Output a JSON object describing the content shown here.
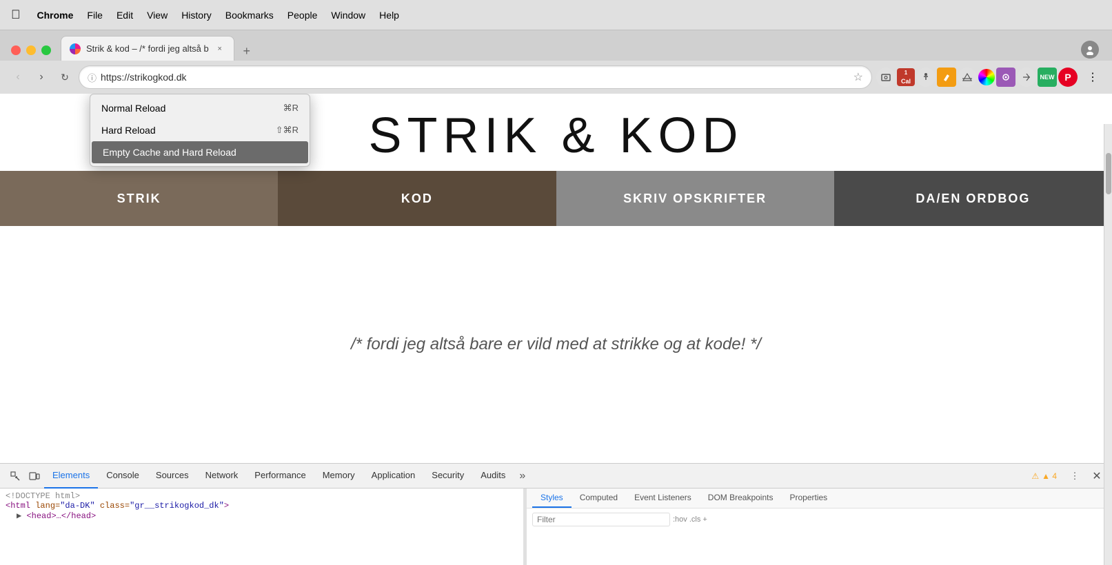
{
  "menubar": {
    "apple": "",
    "app": "Chrome",
    "items": [
      "File",
      "Edit",
      "View",
      "History",
      "Bookmarks",
      "People",
      "Window",
      "Help"
    ]
  },
  "tab": {
    "title": "Strik & kod – /* fordi jeg altså b",
    "close_icon": "×",
    "url": "https://strikogkod.dk"
  },
  "reload_menu": {
    "items": [
      {
        "label": "Normal Reload",
        "shortcut": "⌘R"
      },
      {
        "label": "Hard Reload",
        "shortcut": "⇧⌘R"
      },
      {
        "label": "Empty Cache and Hard Reload",
        "shortcut": ""
      }
    ],
    "selected_index": 2
  },
  "website": {
    "logo": "STRIK & KOD",
    "nav_items": [
      {
        "label": "STRIK",
        "class": "nav-strik"
      },
      {
        "label": "KOD",
        "class": "nav-kod"
      },
      {
        "label": "SKRIV OPSKRIFTER",
        "class": "nav-skriv"
      },
      {
        "label": "DA/EN ORDBOG",
        "class": "nav-daen"
      }
    ],
    "tagline": "/* fordi jeg altså bare er vild med at strikke og at kode! */"
  },
  "devtools": {
    "tabs": [
      "Elements",
      "Console",
      "Sources",
      "Network",
      "Performance",
      "Memory",
      "Application",
      "Security",
      "Audits"
    ],
    "active_tab": "Elements",
    "warning_count": "▲ 4",
    "right_tabs": [
      "Styles",
      "Computed",
      "Event Listeners",
      "DOM Breakpoints",
      "Properties"
    ],
    "active_right_tab": "Styles",
    "filter_placeholder": "Filter",
    "filter_hint": ":hov .cls +",
    "html": [
      "<!DOCTYPE html>",
      "<html lang=\"da-DK\" class=\"gr__strikogkod_dk\">",
      "  ▶ <head>…</head>"
    ]
  },
  "icons": {
    "back": "‹",
    "forward": "›",
    "reload": "↻",
    "security": "ⓘ",
    "star": "☆",
    "more": "⋮",
    "close": "✕",
    "warning": "⚠",
    "element_picker": "⬚",
    "device_toolbar": "□"
  }
}
